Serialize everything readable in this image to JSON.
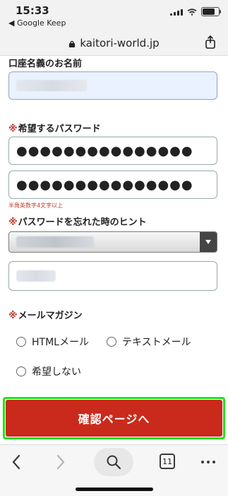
{
  "status_bar": {
    "time": "15:33",
    "back_app": "◀ Google Keep"
  },
  "browser": {
    "url": "kaitori-world.jp",
    "tabs_count": "11"
  },
  "form": {
    "account_name": {
      "label": "口座名義のお名前"
    },
    "password": {
      "required_mark": "※",
      "label": "希望するパスワード",
      "value": "●●●●●●●●●●●●●●●",
      "confirm_value": "●●●●●●●●●●●●●●●",
      "note": "半角英数字4文字以上"
    },
    "password_hint": {
      "required_mark": "※",
      "label": "パスワードを忘れた時のヒント"
    },
    "newsletter": {
      "required_mark": "※",
      "label": "メールマガジン",
      "options": [
        "HTMLメール",
        "テキストメール",
        "希望しない"
      ]
    },
    "submit_label": "確認ページへ"
  },
  "colors": {
    "accent_red": "#c92a1b",
    "highlight_green": "#24e31b",
    "required_red": "#c0392b"
  }
}
